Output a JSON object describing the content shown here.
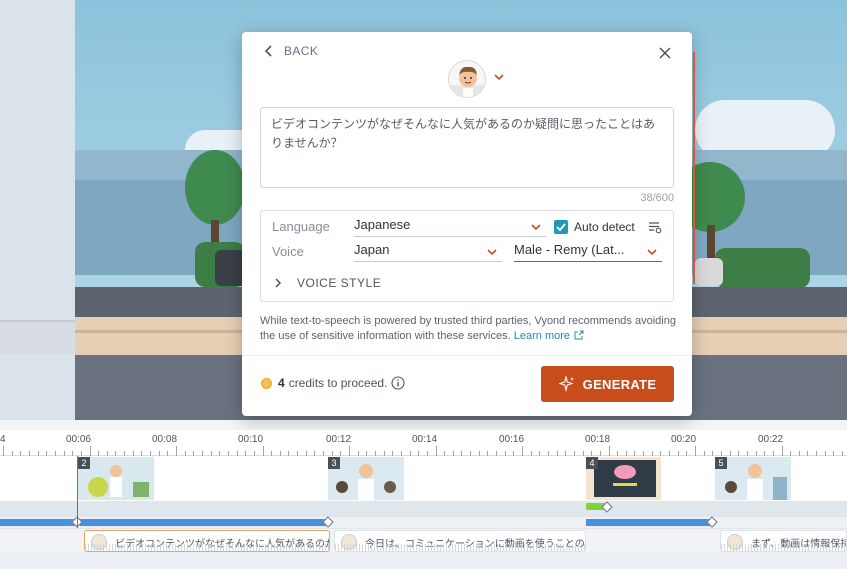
{
  "modal": {
    "back_label": "BACK",
    "text": "ビデオコンテンツがなぜそんなに人気があるのか疑問に思ったことはありませんか？",
    "char_count": "38/600",
    "language_label": "Language",
    "language_value": "Japanese",
    "auto_detect_label": "Auto detect",
    "auto_detect_checked": true,
    "voice_label": "Voice",
    "voice_region": "Japan",
    "voice_name": "Male - Remy (Lat...",
    "voice_style_label": "VOICE STYLE",
    "disclaimer": "While text-to-speech is powered by trusted third parties, Vyond recommends avoiding the use of sensitive information with these services.",
    "learn_more": "Learn more",
    "credits_count": "4",
    "credits_text": "credits to proceed.",
    "generate_label": "GENERATE"
  },
  "timeline": {
    "ticks": [
      "4",
      "00:06",
      "00:08",
      "00:10",
      "00:12",
      "00:14",
      "00:16",
      "00:18",
      "00:20",
      "00:22"
    ],
    "scenes": [
      "2",
      "3",
      "4",
      "5"
    ],
    "audio_clips": [
      "ビデオコンテンツがなぜそんなに人気があるのか",
      "今日は、コミュニケーションに動画を使うことの",
      "まず、動画は情報保持"
    ]
  },
  "colors": {
    "accent": "#c94d1b",
    "checkbox": "#2497b6",
    "timeline_bar": "#4a90e2",
    "link": "#1b8cb0"
  },
  "icons": {
    "back": "chevron-left-icon",
    "close": "close-icon",
    "avatar_dropdown": "chevron-down-icon",
    "dropdown": "chevron-down-icon",
    "voice_list": "playlist-settings-icon",
    "voice_style": "chevron-right-icon",
    "external_link": "external-link-icon",
    "credit": "coin-icon",
    "info": "info-icon",
    "generate": "sparkle-icon"
  }
}
